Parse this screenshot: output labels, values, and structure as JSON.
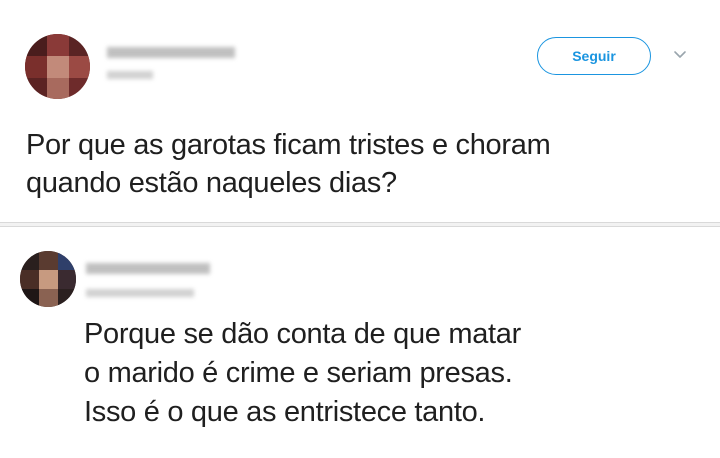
{
  "tweet": {
    "text": "Por que as garotas ficam tristes e choram\nquando estão naqueles dias?",
    "follow_label": "Seguir",
    "menu_icon": "chevron-down-icon"
  },
  "reply": {
    "text": "Porque se dão conta de que matar\no marido é crime e seriam presas.\nIsso é o que as entristece tanto."
  },
  "colors": {
    "accent": "#1b95e0",
    "text": "#1f1f1f",
    "divider": "#d9d9d9"
  }
}
